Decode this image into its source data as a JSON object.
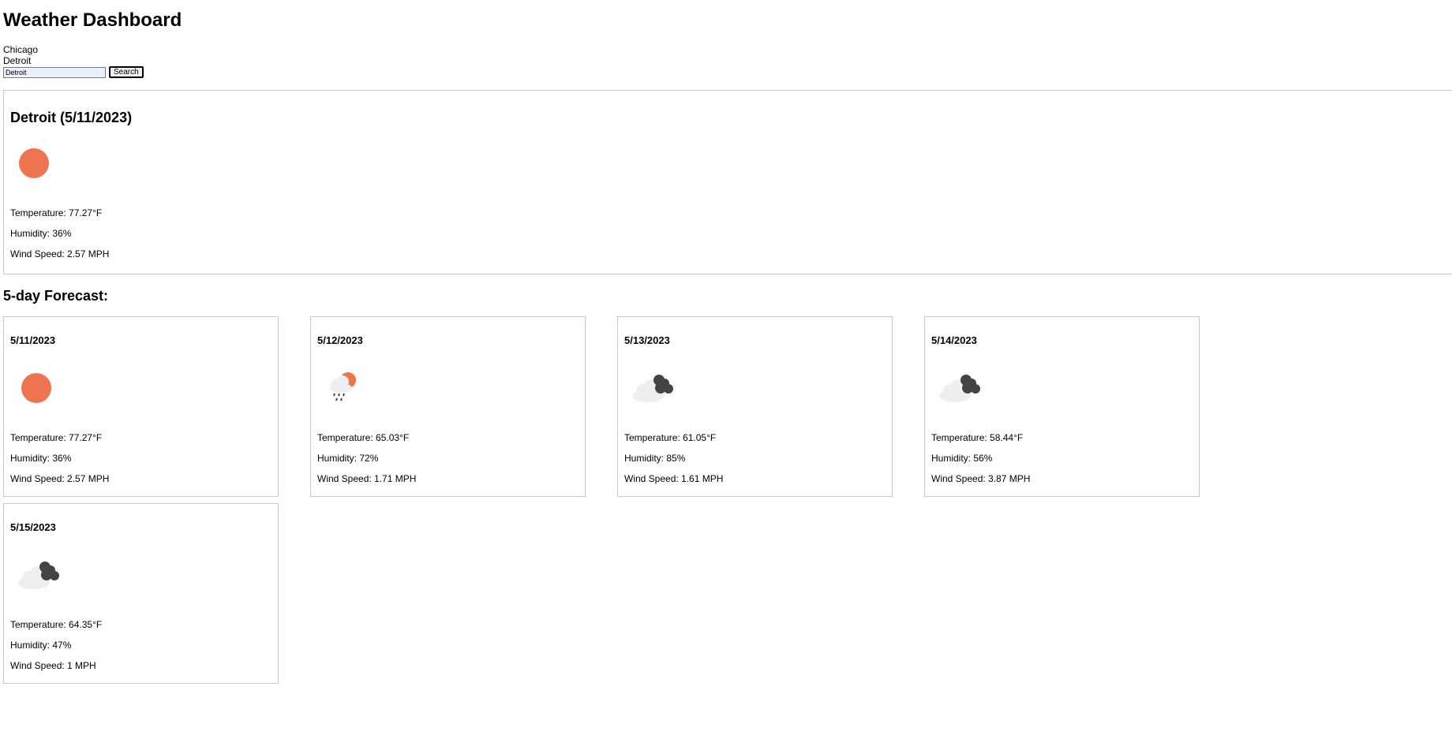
{
  "header": {
    "title": "Weather Dashboard"
  },
  "history": [
    "Chicago",
    "Detroit"
  ],
  "search": {
    "value": "Detroit",
    "button_label": "Search"
  },
  "current": {
    "heading": "Detroit (5/11/2023)",
    "icon": "sun-icon",
    "temperature": "Temperature: 77.27°F",
    "humidity": "Humidity: 36%",
    "wind": "Wind Speed: 2.57 MPH"
  },
  "forecast": {
    "title": "5-day Forecast:",
    "days": [
      {
        "date": "5/11/2023",
        "icon": "sun-icon",
        "temperature": "Temperature: 77.27°F",
        "humidity": "Humidity: 36%",
        "wind": "Wind Speed: 2.57 MPH"
      },
      {
        "date": "5/12/2023",
        "icon": "rain-sun-icon",
        "temperature": "Temperature: 65.03°F",
        "humidity": "Humidity: 72%",
        "wind": "Wind Speed: 1.71 MPH"
      },
      {
        "date": "5/13/2023",
        "icon": "dark-cloud-icon",
        "temperature": "Temperature: 61.05°F",
        "humidity": "Humidity: 85%",
        "wind": "Wind Speed: 1.61 MPH"
      },
      {
        "date": "5/14/2023",
        "icon": "dark-cloud-icon",
        "temperature": "Temperature: 58.44°F",
        "humidity": "Humidity: 56%",
        "wind": "Wind Speed: 3.87 MPH"
      },
      {
        "date": "5/15/2023",
        "icon": "dark-cloud-icon",
        "temperature": "Temperature: 64.35°F",
        "humidity": "Humidity: 47%",
        "wind": "Wind Speed: 1 MPH"
      }
    ]
  },
  "colors": {
    "sun": "#f07350",
    "cloud_dark": "#444444",
    "cloud_light": "#eeeeee",
    "border": "#c7c7c7"
  }
}
